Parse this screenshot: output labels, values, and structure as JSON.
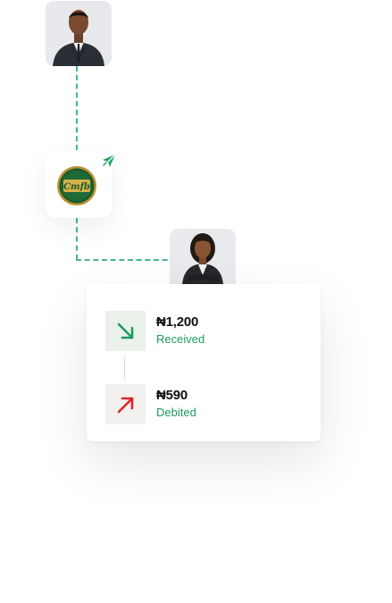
{
  "people": {
    "sender_avatar": "male-avatar",
    "receiver_avatar": "female-avatar"
  },
  "bank": {
    "logo_text": "Cmfb"
  },
  "icons": {
    "send": "paper-plane-icon",
    "received": "arrow-down-right-icon",
    "debited": "arrow-up-right-icon"
  },
  "colors": {
    "accent_green": "#1e9a5e",
    "connector_green": "#46b58a",
    "debit_red": "#e0242b"
  },
  "transactions": [
    {
      "amount": "₦1,200",
      "label": "Received"
    },
    {
      "amount": "₦590",
      "label": "Debited"
    }
  ]
}
